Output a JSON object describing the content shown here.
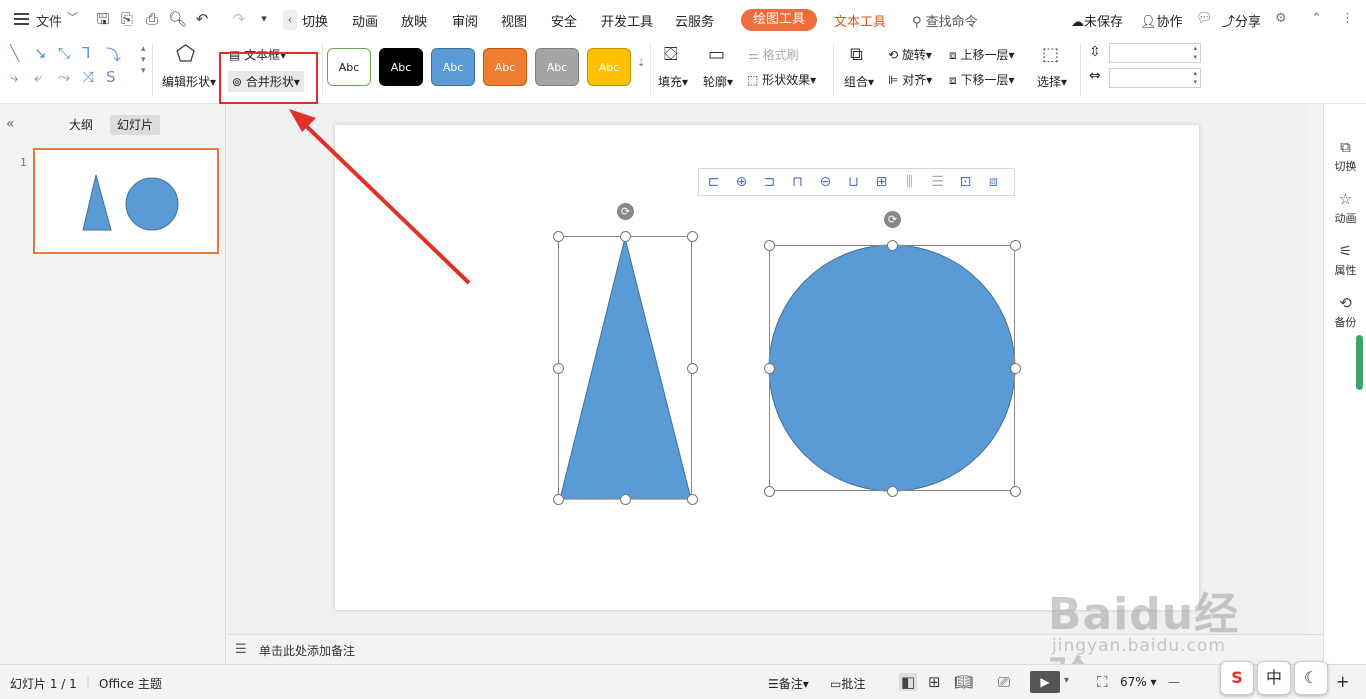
{
  "menu": {
    "file_label": "文件",
    "tabs": [
      "切换",
      "动画",
      "放映",
      "审阅",
      "视图",
      "安全",
      "开发工具",
      "云服务"
    ],
    "drawing_tools_tab": "绘图工具",
    "text_tools_tab": "文本工具",
    "search_placeholder": "查找命令",
    "unsaved_label": "未保存",
    "collab_label": "协作",
    "share_label": "分享"
  },
  "ribbon": {
    "edit_shape_label": "编辑形状",
    "textbox_label": "文本框",
    "merge_shape_label": "合并形状",
    "style_presets": [
      {
        "label": "Abc",
        "bg": "#ffffff",
        "border": "#6aa84f",
        "text": "#222222"
      },
      {
        "label": "Abc",
        "bg": "#000000",
        "border": "#000000",
        "text": "#ffffff"
      },
      {
        "label": "Abc",
        "bg": "#5b9bd5",
        "border": "#41719c",
        "text": "#ffffff"
      },
      {
        "label": "Abc",
        "bg": "#ed7d31",
        "border": "#c65911",
        "text": "#ffffff"
      },
      {
        "label": "Abc",
        "bg": "#a5a5a5",
        "border": "#7f7f7f",
        "text": "#ffffff"
      },
      {
        "label": "Abc",
        "bg": "#ffc000",
        "border": "#bf9000",
        "text": "#ffffff"
      }
    ],
    "fill_label": "填充",
    "outline_label": "轮廓",
    "format_painter_label": "格式刷",
    "shape_effects_label": "形状效果",
    "group_label": "组合",
    "rotate_label": "旋转",
    "align_label": "对齐",
    "bring_forward_label": "上移一层",
    "send_backward_label": "下移一层",
    "select_label": "选择"
  },
  "left_panel": {
    "outline_tab": "大纲",
    "slides_tab": "幻灯片",
    "slide_number": "1"
  },
  "notes": {
    "placeholder": "单击此处添加备注"
  },
  "right_sidebar": {
    "items": [
      {
        "label": "切换",
        "icon": "transition-icon"
      },
      {
        "label": "动画",
        "icon": "animation-icon"
      },
      {
        "label": "属性",
        "icon": "properties-icon"
      },
      {
        "label": "备份",
        "icon": "backup-icon"
      }
    ]
  },
  "status": {
    "slide_info": "幻灯片 1 / 1",
    "theme": "Office 主题",
    "notes_btn": "备注",
    "comment_btn": "批注",
    "zoom": "67%"
  },
  "ime": {
    "lang": "中"
  },
  "watermark": {
    "brand": "Baidu经验",
    "url": "jingyan.baidu.com"
  },
  "colors": {
    "accent": "#ef6c3c",
    "shape_fill": "#5b9bd5",
    "shape_stroke": "#41719c",
    "highlight_red": "#e0302a"
  }
}
